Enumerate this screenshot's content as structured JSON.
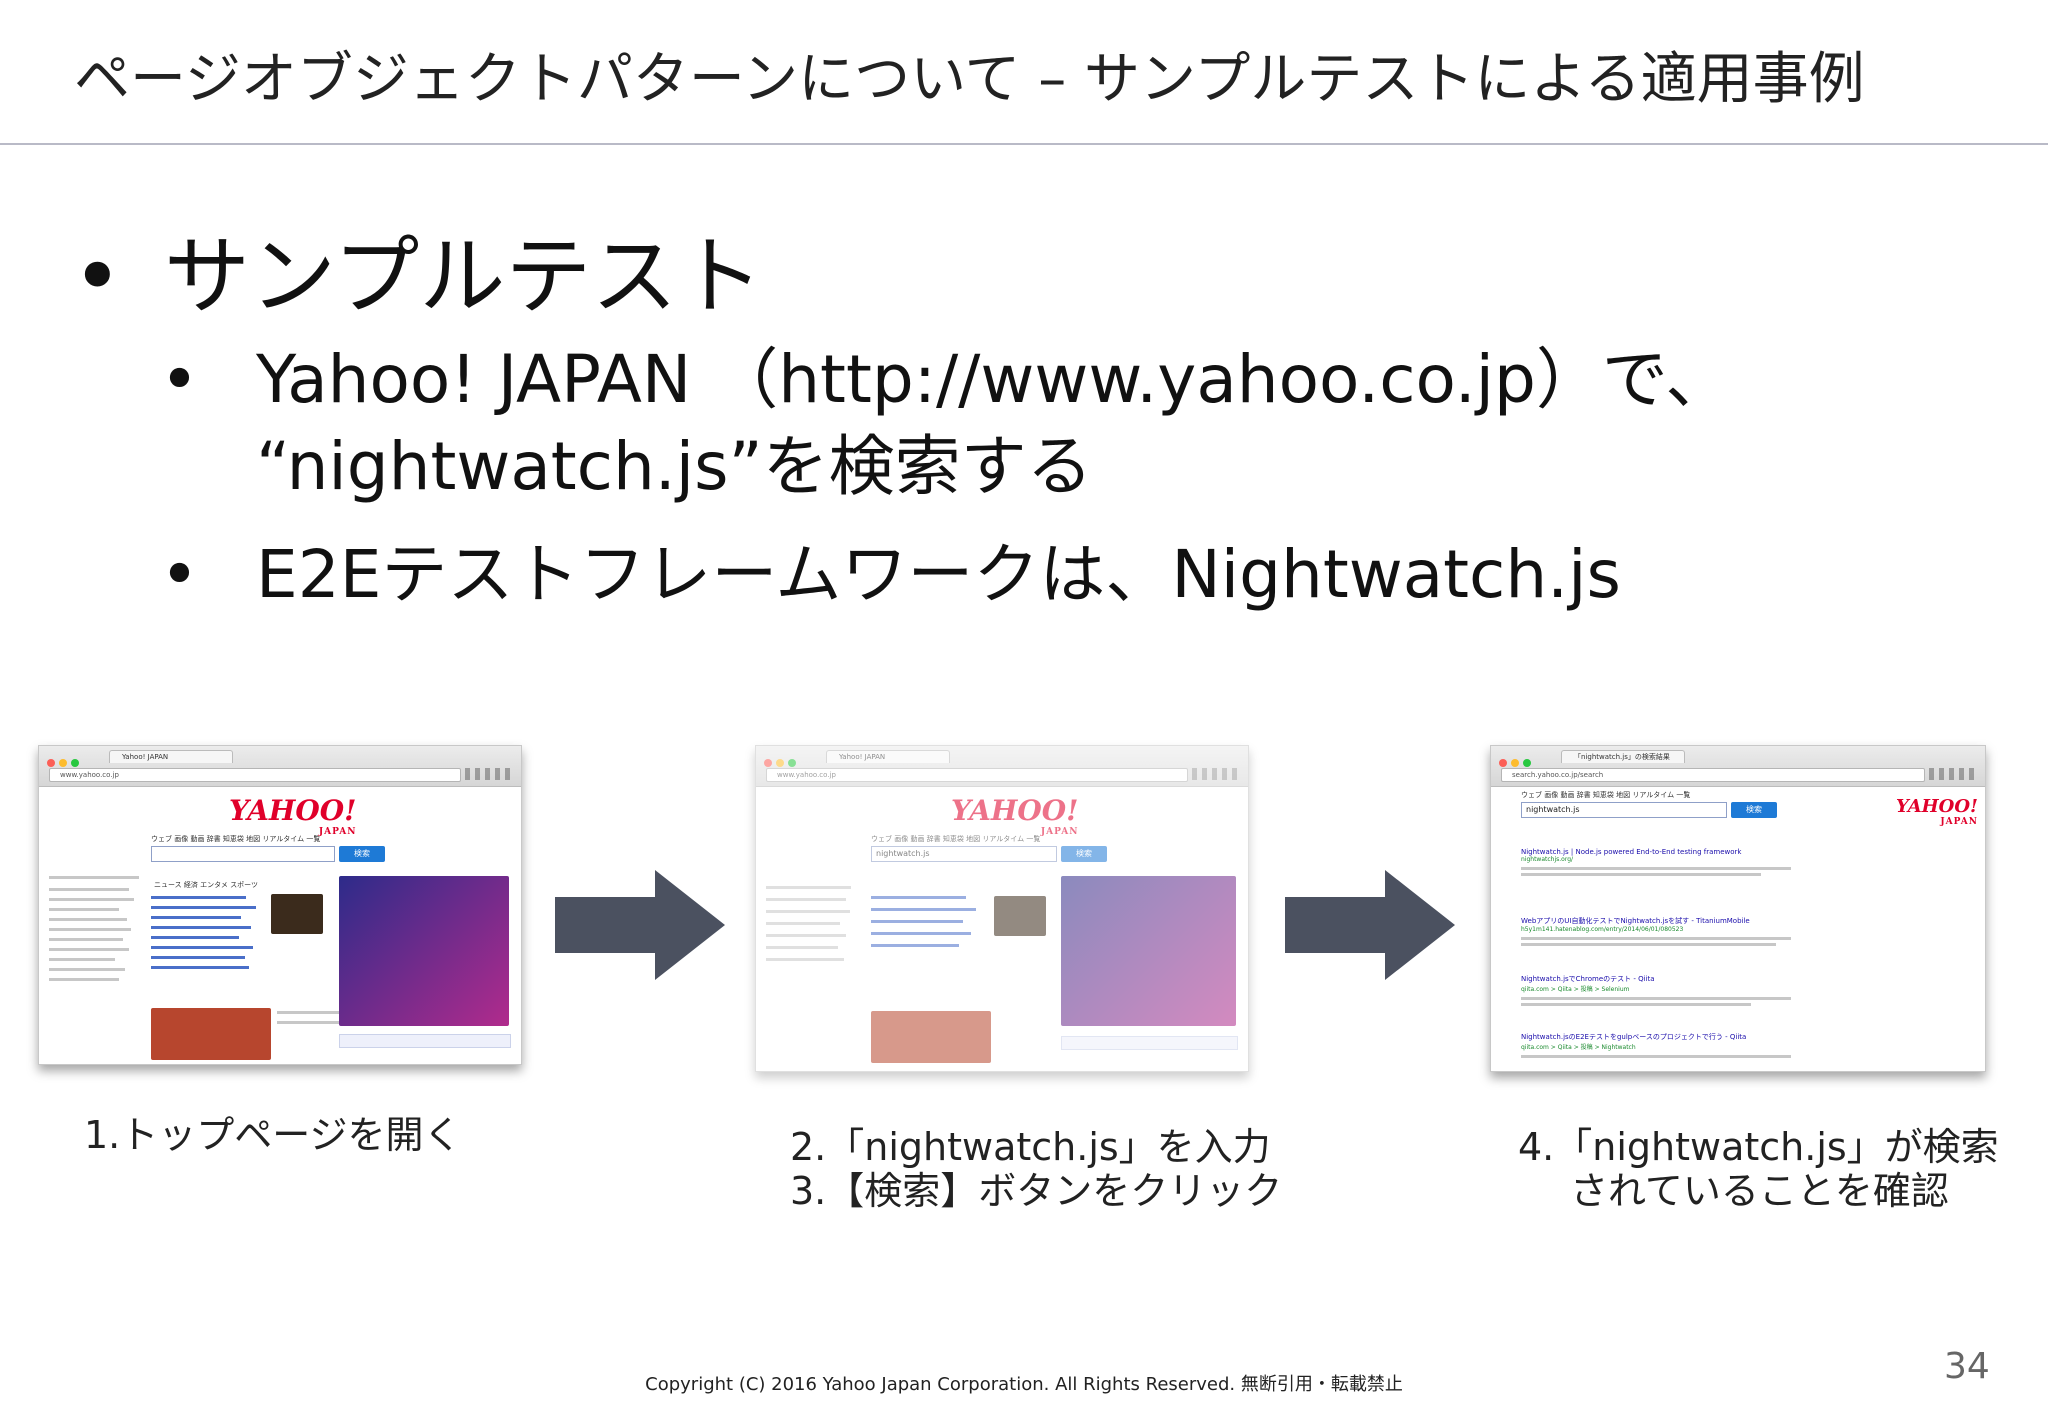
{
  "slide": {
    "title": "ページオブジェクトパターンについて – サンプルテストによる適用事例",
    "bullets": {
      "main": "サンプルテスト",
      "sub1_line1": "Yahoo! JAPAN （http://www.yahoo.co.jp）で、",
      "sub1_line2": "“nightwatch.js”を検索する",
      "sub2": "E2Eテストフレームワークは、Nightwatch.js"
    },
    "bullet_glyph": "•",
    "captions": {
      "step1": "1.トップページを開く",
      "step2": "2.「nightwatch.js」を入力",
      "step3": "3.【検索】ボタンをクリック",
      "step4_line1": "4.「nightwatch.js」が検索",
      "step4_line2": "されていることを確認"
    },
    "page_number": "34",
    "footer": "Copyright (C) 2016 Yahoo Japan Corporation. All Rights Reserved. 無断引用・転載禁止"
  },
  "screenshots": {
    "shot1": {
      "tab_title": "Yahoo! JAPAN",
      "url": "www.yahoo.co.jp",
      "logo": "YAHOO!",
      "logo_sub": "JAPAN",
      "nav_tabs": "ウェブ 画像 動画 辞書 知恵袋 地図 リアルタイム 一覧",
      "search_button": "検索",
      "news_tabs": "ニュース 経済 エンタメ スポーツ"
    },
    "shot2": {
      "tab_title": "Yahoo! JAPAN",
      "url": "www.yahoo.co.jp",
      "logo": "YAHOO!",
      "logo_sub": "JAPAN",
      "nav_tabs": "ウェブ 画像 動画 辞書 知恵袋 地図 リアルタイム 一覧",
      "search_value": "nightwatch.js",
      "search_button": "検索"
    },
    "shot3": {
      "tab_title": "「nightwatch.js」の検索結果",
      "url": "search.yahoo.co.jp/search",
      "nav_tabs": "ウェブ 画像 動画 辞書 知恵袋 地図 リアルタイム 一覧",
      "search_value": "nightwatch.js",
      "search_button": "検索",
      "logo": "YAHOO!",
      "logo_sub": "JAPAN",
      "results": [
        {
          "title": "Nightwatch.js | Node.js powered End-to-End testing framework",
          "url": "nightwatchjs.org/"
        },
        {
          "title": "WebアプリのUI自動化テストでNightwatch.jsを試す - TitaniumMobile",
          "url": "h5y1m141.hatenablog.com/entry/2014/06/01/080523"
        },
        {
          "title": "Nightwatch.jsでChromeのテスト - Qiita",
          "url": "qiita.com > Qiita > 投稿 > Selenium"
        },
        {
          "title": "Nightwatch.jsのE2Eテストをgulpベースのプロジェクトで行う - Qiita",
          "url": "qiita.com > Qiita > 投稿 > Nightwatch"
        }
      ]
    }
  },
  "colors": {
    "title_rule": "#b9bac7",
    "arrow": "#4b5160",
    "yahoo_red": "#e0002a",
    "link_blue": "#1a0dab",
    "url_green": "#1a8a2e"
  }
}
